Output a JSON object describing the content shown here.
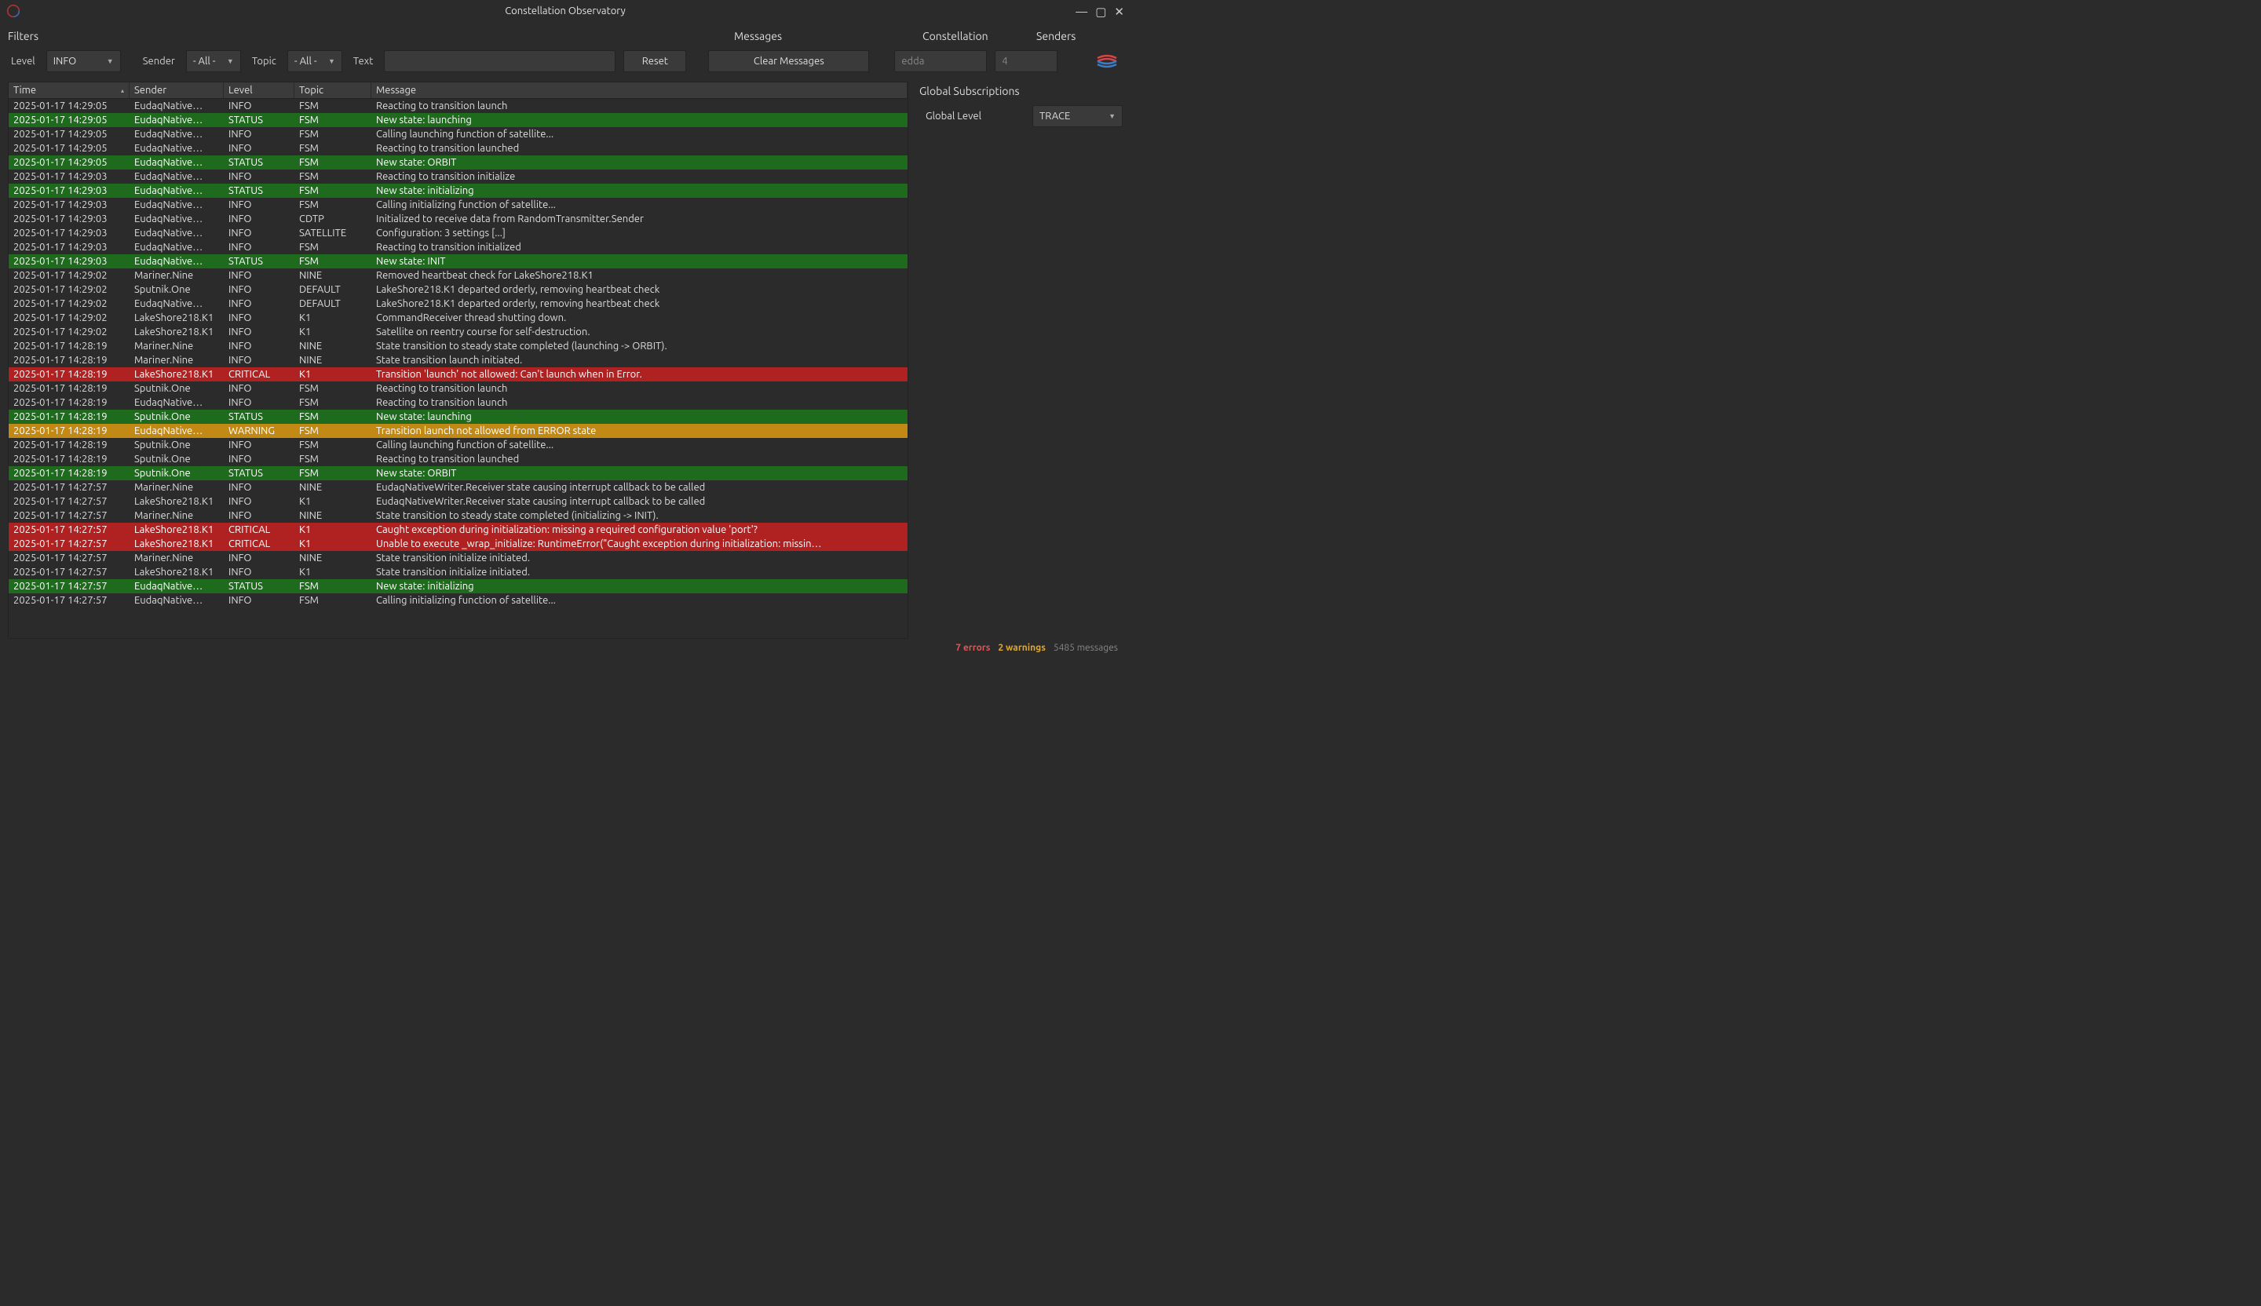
{
  "window": {
    "title": "Constellation Observatory"
  },
  "filters": {
    "section_label": "Filters",
    "level_label": "Level",
    "level_value": "INFO",
    "sender_label": "Sender",
    "sender_value": "- All -",
    "topic_label": "Topic",
    "topic_value": "- All -",
    "text_label": "Text",
    "text_value": "",
    "reset_label": "Reset"
  },
  "messages_panel": {
    "section_label": "Messages",
    "clear_label": "Clear Messages"
  },
  "constellation": {
    "section_label": "Constellation",
    "value": "edda"
  },
  "senders": {
    "section_label": "Senders",
    "value": "4"
  },
  "table": {
    "headers": {
      "time": "Time",
      "sender": "Sender",
      "level": "Level",
      "topic": "Topic",
      "message": "Message"
    },
    "rows": [
      {
        "time": "2025-01-17 14:29:05",
        "sender": "EudaqNative…",
        "level": "INFO",
        "topic": "FSM",
        "message": "Reacting to transition launch"
      },
      {
        "time": "2025-01-17 14:29:05",
        "sender": "EudaqNative…",
        "level": "STATUS",
        "topic": "FSM",
        "message": "New state: launching"
      },
      {
        "time": "2025-01-17 14:29:05",
        "sender": "EudaqNative…",
        "level": "INFO",
        "topic": "FSM",
        "message": "Calling launching function of satellite..."
      },
      {
        "time": "2025-01-17 14:29:05",
        "sender": "EudaqNative…",
        "level": "INFO",
        "topic": "FSM",
        "message": "Reacting to transition launched"
      },
      {
        "time": "2025-01-17 14:29:05",
        "sender": "EudaqNative…",
        "level": "STATUS",
        "topic": "FSM",
        "message": "New state: ORBIT"
      },
      {
        "time": "2025-01-17 14:29:03",
        "sender": "EudaqNative…",
        "level": "INFO",
        "topic": "FSM",
        "message": "Reacting to transition initialize"
      },
      {
        "time": "2025-01-17 14:29:03",
        "sender": "EudaqNative…",
        "level": "STATUS",
        "topic": "FSM",
        "message": "New state: initializing"
      },
      {
        "time": "2025-01-17 14:29:03",
        "sender": "EudaqNative…",
        "level": "INFO",
        "topic": "FSM",
        "message": "Calling initializing function of satellite..."
      },
      {
        "time": "2025-01-17 14:29:03",
        "sender": "EudaqNative…",
        "level": "INFO",
        "topic": "CDTP",
        "message": "Initialized to receive data from RandomTransmitter.Sender"
      },
      {
        "time": "2025-01-17 14:29:03",
        "sender": "EudaqNative…",
        "level": "INFO",
        "topic": "SATELLITE",
        "message": "Configuration: 3 settings [...]"
      },
      {
        "time": "2025-01-17 14:29:03",
        "sender": "EudaqNative…",
        "level": "INFO",
        "topic": "FSM",
        "message": "Reacting to transition initialized"
      },
      {
        "time": "2025-01-17 14:29:03",
        "sender": "EudaqNative…",
        "level": "STATUS",
        "topic": "FSM",
        "message": "New state: INIT"
      },
      {
        "time": "2025-01-17 14:29:02",
        "sender": "Mariner.Nine",
        "level": "INFO",
        "topic": "NINE",
        "message": "Removed heartbeat check for LakeShore218.K1"
      },
      {
        "time": "2025-01-17 14:29:02",
        "sender": "Sputnik.One",
        "level": "INFO",
        "topic": "DEFAULT",
        "message": "LakeShore218.K1 departed orderly, removing heartbeat check"
      },
      {
        "time": "2025-01-17 14:29:02",
        "sender": "EudaqNative…",
        "level": "INFO",
        "topic": "DEFAULT",
        "message": "LakeShore218.K1 departed orderly, removing heartbeat check"
      },
      {
        "time": "2025-01-17 14:29:02",
        "sender": "LakeShore218.K1",
        "level": "INFO",
        "topic": "K1",
        "message": "CommandReceiver thread shutting down."
      },
      {
        "time": "2025-01-17 14:29:02",
        "sender": "LakeShore218.K1",
        "level": "INFO",
        "topic": "K1",
        "message": "Satellite on reentry course for self-destruction."
      },
      {
        "time": "2025-01-17 14:28:19",
        "sender": "Mariner.Nine",
        "level": "INFO",
        "topic": "NINE",
        "message": "State transition to steady state completed (launching -> ORBIT)."
      },
      {
        "time": "2025-01-17 14:28:19",
        "sender": "Mariner.Nine",
        "level": "INFO",
        "topic": "NINE",
        "message": "State transition launch initiated."
      },
      {
        "time": "2025-01-17 14:28:19",
        "sender": "LakeShore218.K1",
        "level": "CRITICAL",
        "topic": "K1",
        "message": "Transition 'launch' not allowed: Can't launch when in Error."
      },
      {
        "time": "2025-01-17 14:28:19",
        "sender": "Sputnik.One",
        "level": "INFO",
        "topic": "FSM",
        "message": "Reacting to transition launch"
      },
      {
        "time": "2025-01-17 14:28:19",
        "sender": "EudaqNative…",
        "level": "INFO",
        "topic": "FSM",
        "message": "Reacting to transition launch"
      },
      {
        "time": "2025-01-17 14:28:19",
        "sender": "Sputnik.One",
        "level": "STATUS",
        "topic": "FSM",
        "message": "New state: launching"
      },
      {
        "time": "2025-01-17 14:28:19",
        "sender": "EudaqNative…",
        "level": "WARNING",
        "topic": "FSM",
        "message": "Transition launch not allowed from ERROR state"
      },
      {
        "time": "2025-01-17 14:28:19",
        "sender": "Sputnik.One",
        "level": "INFO",
        "topic": "FSM",
        "message": "Calling launching function of satellite..."
      },
      {
        "time": "2025-01-17 14:28:19",
        "sender": "Sputnik.One",
        "level": "INFO",
        "topic": "FSM",
        "message": "Reacting to transition launched"
      },
      {
        "time": "2025-01-17 14:28:19",
        "sender": "Sputnik.One",
        "level": "STATUS",
        "topic": "FSM",
        "message": "New state: ORBIT"
      },
      {
        "time": "2025-01-17 14:27:57",
        "sender": "Mariner.Nine",
        "level": "INFO",
        "topic": "NINE",
        "message": "EudaqNativeWriter.Receiver state causing interrupt callback to be called"
      },
      {
        "time": "2025-01-17 14:27:57",
        "sender": "LakeShore218.K1",
        "level": "INFO",
        "topic": "K1",
        "message": "EudaqNativeWriter.Receiver state causing interrupt callback to be called"
      },
      {
        "time": "2025-01-17 14:27:57",
        "sender": "Mariner.Nine",
        "level": "INFO",
        "topic": "NINE",
        "message": "State transition to steady state completed (initializing -> INIT)."
      },
      {
        "time": "2025-01-17 14:27:57",
        "sender": "LakeShore218.K1",
        "level": "CRITICAL",
        "topic": "K1",
        "message": "Caught exception during initialization: missing a required configuration value 'port'?"
      },
      {
        "time": "2025-01-17 14:27:57",
        "sender": "LakeShore218.K1",
        "level": "CRITICAL",
        "topic": "K1",
        "message": "Unable to execute _wrap_initialize: RuntimeError(\"Caught exception during initialization: missin…"
      },
      {
        "time": "2025-01-17 14:27:57",
        "sender": "Mariner.Nine",
        "level": "INFO",
        "topic": "NINE",
        "message": "State transition initialize initiated."
      },
      {
        "time": "2025-01-17 14:27:57",
        "sender": "LakeShore218.K1",
        "level": "INFO",
        "topic": "K1",
        "message": "State transition initialize initiated."
      },
      {
        "time": "2025-01-17 14:27:57",
        "sender": "EudaqNative…",
        "level": "STATUS",
        "topic": "FSM",
        "message": "New state: initializing"
      },
      {
        "time": "2025-01-17 14:27:57",
        "sender": "EudaqNative…",
        "level": "INFO",
        "topic": "FSM",
        "message": "Calling initializing function of satellite..."
      }
    ]
  },
  "global_subscriptions": {
    "title": "Global Subscriptions",
    "level_label": "Global Level",
    "level_value": "TRACE"
  },
  "statusbar": {
    "errors": "7 errors",
    "warnings": "2 warnings",
    "messages": "5485 messages"
  }
}
